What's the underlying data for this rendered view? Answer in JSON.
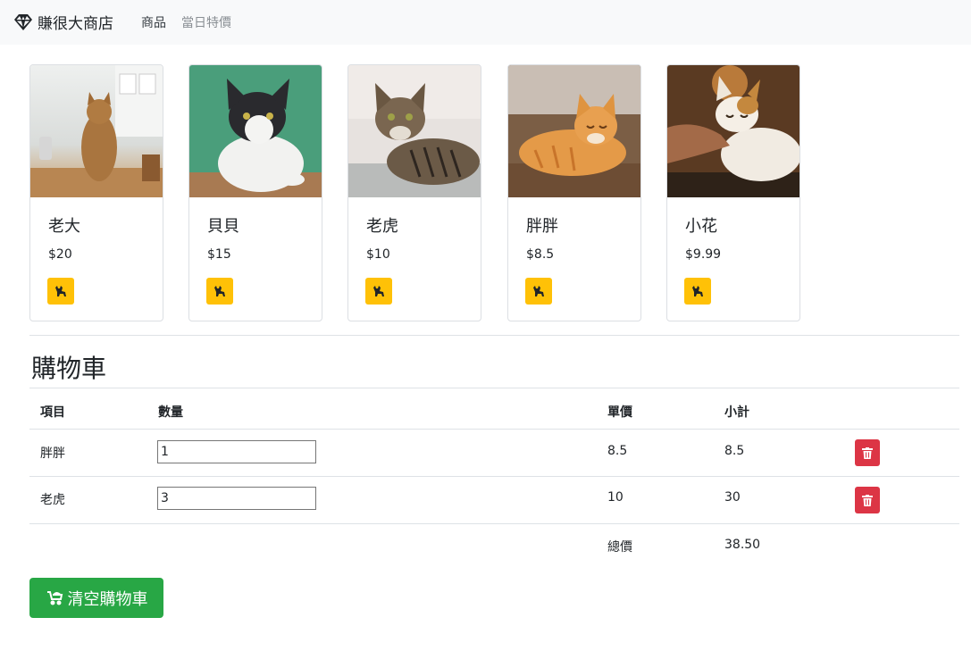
{
  "navbar": {
    "brand": "賺很大商店",
    "links": [
      "商品",
      "當日特價"
    ]
  },
  "products": [
    {
      "name": "老大",
      "price": "$20",
      "image": "tabby-cat-sitting-kitchen"
    },
    {
      "name": "貝貝",
      "price": "$15",
      "image": "black-white-cat-green-wall"
    },
    {
      "name": "老虎",
      "price": "$10",
      "image": "striped-tabby-cat-lying"
    },
    {
      "name": "胖胖",
      "price": "$8.5",
      "image": "orange-cat-lying-floor"
    },
    {
      "name": "小花",
      "price": "$9.99",
      "image": "calico-cat-petted"
    }
  ],
  "cart": {
    "title": "購物車",
    "headers": {
      "item": "項目",
      "qty": "數量",
      "price": "單價",
      "subtotal": "小計"
    },
    "rows": [
      {
        "item": "胖胖",
        "qty": "1",
        "price": "8.5",
        "subtotal": "8.5"
      },
      {
        "item": "老虎",
        "qty": "3",
        "price": "10",
        "subtotal": "30"
      }
    ],
    "total_label": "總價",
    "total_value": "38.50",
    "clear_label": "清空購物車"
  },
  "colors": {
    "add_button": "#ffc107",
    "delete_button": "#dc3545",
    "clear_button": "#28a745",
    "navbar_bg": "#f8f9fa"
  }
}
